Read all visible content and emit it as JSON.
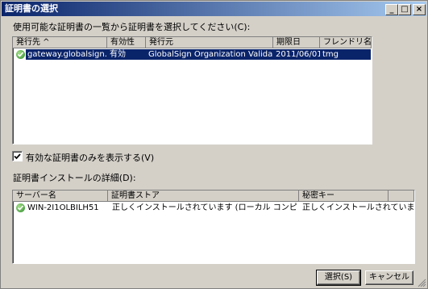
{
  "window": {
    "title": "証明書の選択"
  },
  "titlebar": {
    "minimize": "_",
    "maximize": "□",
    "close": "×"
  },
  "instruction": "使用可能な証明書の一覧から証明書を選択してください(C):",
  "cert_list": {
    "columns": [
      "発行先 ^",
      "有効性",
      "発行元",
      "期限日",
      "フレンドリ名"
    ],
    "rows": [
      {
        "issued_to": "gateway.globalsign.co.jp",
        "validity": "有効",
        "issuer": "GlobalSign Organization Validation C...",
        "expires": "2011/06/01",
        "friendly_name": "tmg"
      }
    ]
  },
  "valid_only": {
    "label": "有効な証明書のみを表示する(V)",
    "checked": true
  },
  "install_details_label": "証明書インストールの詳細(D):",
  "install_list": {
    "columns": [
      "サーバー名",
      "証明書ストア",
      "秘密キー"
    ],
    "rows": [
      {
        "server": "WIN-2I1OLBILH51",
        "store": "正しくインストールされています (ローカル コンピューター、個人用)",
        "private_key": "正しくインストールされています"
      }
    ]
  },
  "buttons": {
    "select": "選択(S)",
    "cancel": "キャンセル"
  }
}
